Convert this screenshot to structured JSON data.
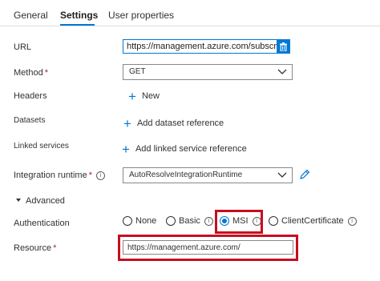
{
  "tabs": [
    {
      "label": "General"
    },
    {
      "label": "Settings"
    },
    {
      "label": "User properties"
    }
  ],
  "fields": {
    "url_label": "URL",
    "url_value": "https://management.azure.com/subscrip",
    "method_label": "Method",
    "method_value": "GET",
    "headers_label": "Headers",
    "headers_add": "New",
    "datasets_label": "Datasets",
    "datasets_add": "Add dataset reference",
    "linked_services_label": "Linked services",
    "linked_services_add": "Add linked service reference",
    "integration_runtime_label": "Integration runtime",
    "integration_runtime_value": "AutoResolveIntegrationRuntime",
    "advanced_label": "Advanced",
    "authentication_label": "Authentication",
    "resource_label": "Resource",
    "resource_value": "https://management.azure.com/"
  },
  "required_marker": "*",
  "info_glyph": "i",
  "auth_options": [
    {
      "label": "None",
      "checked": false
    },
    {
      "label": "Basic",
      "checked": false
    },
    {
      "label": "MSI",
      "checked": true
    },
    {
      "label": "ClientCertificate",
      "checked": false
    }
  ],
  "colors": {
    "accent": "#0078d4",
    "highlight": "#c50f1f",
    "required": "#a4262c"
  }
}
